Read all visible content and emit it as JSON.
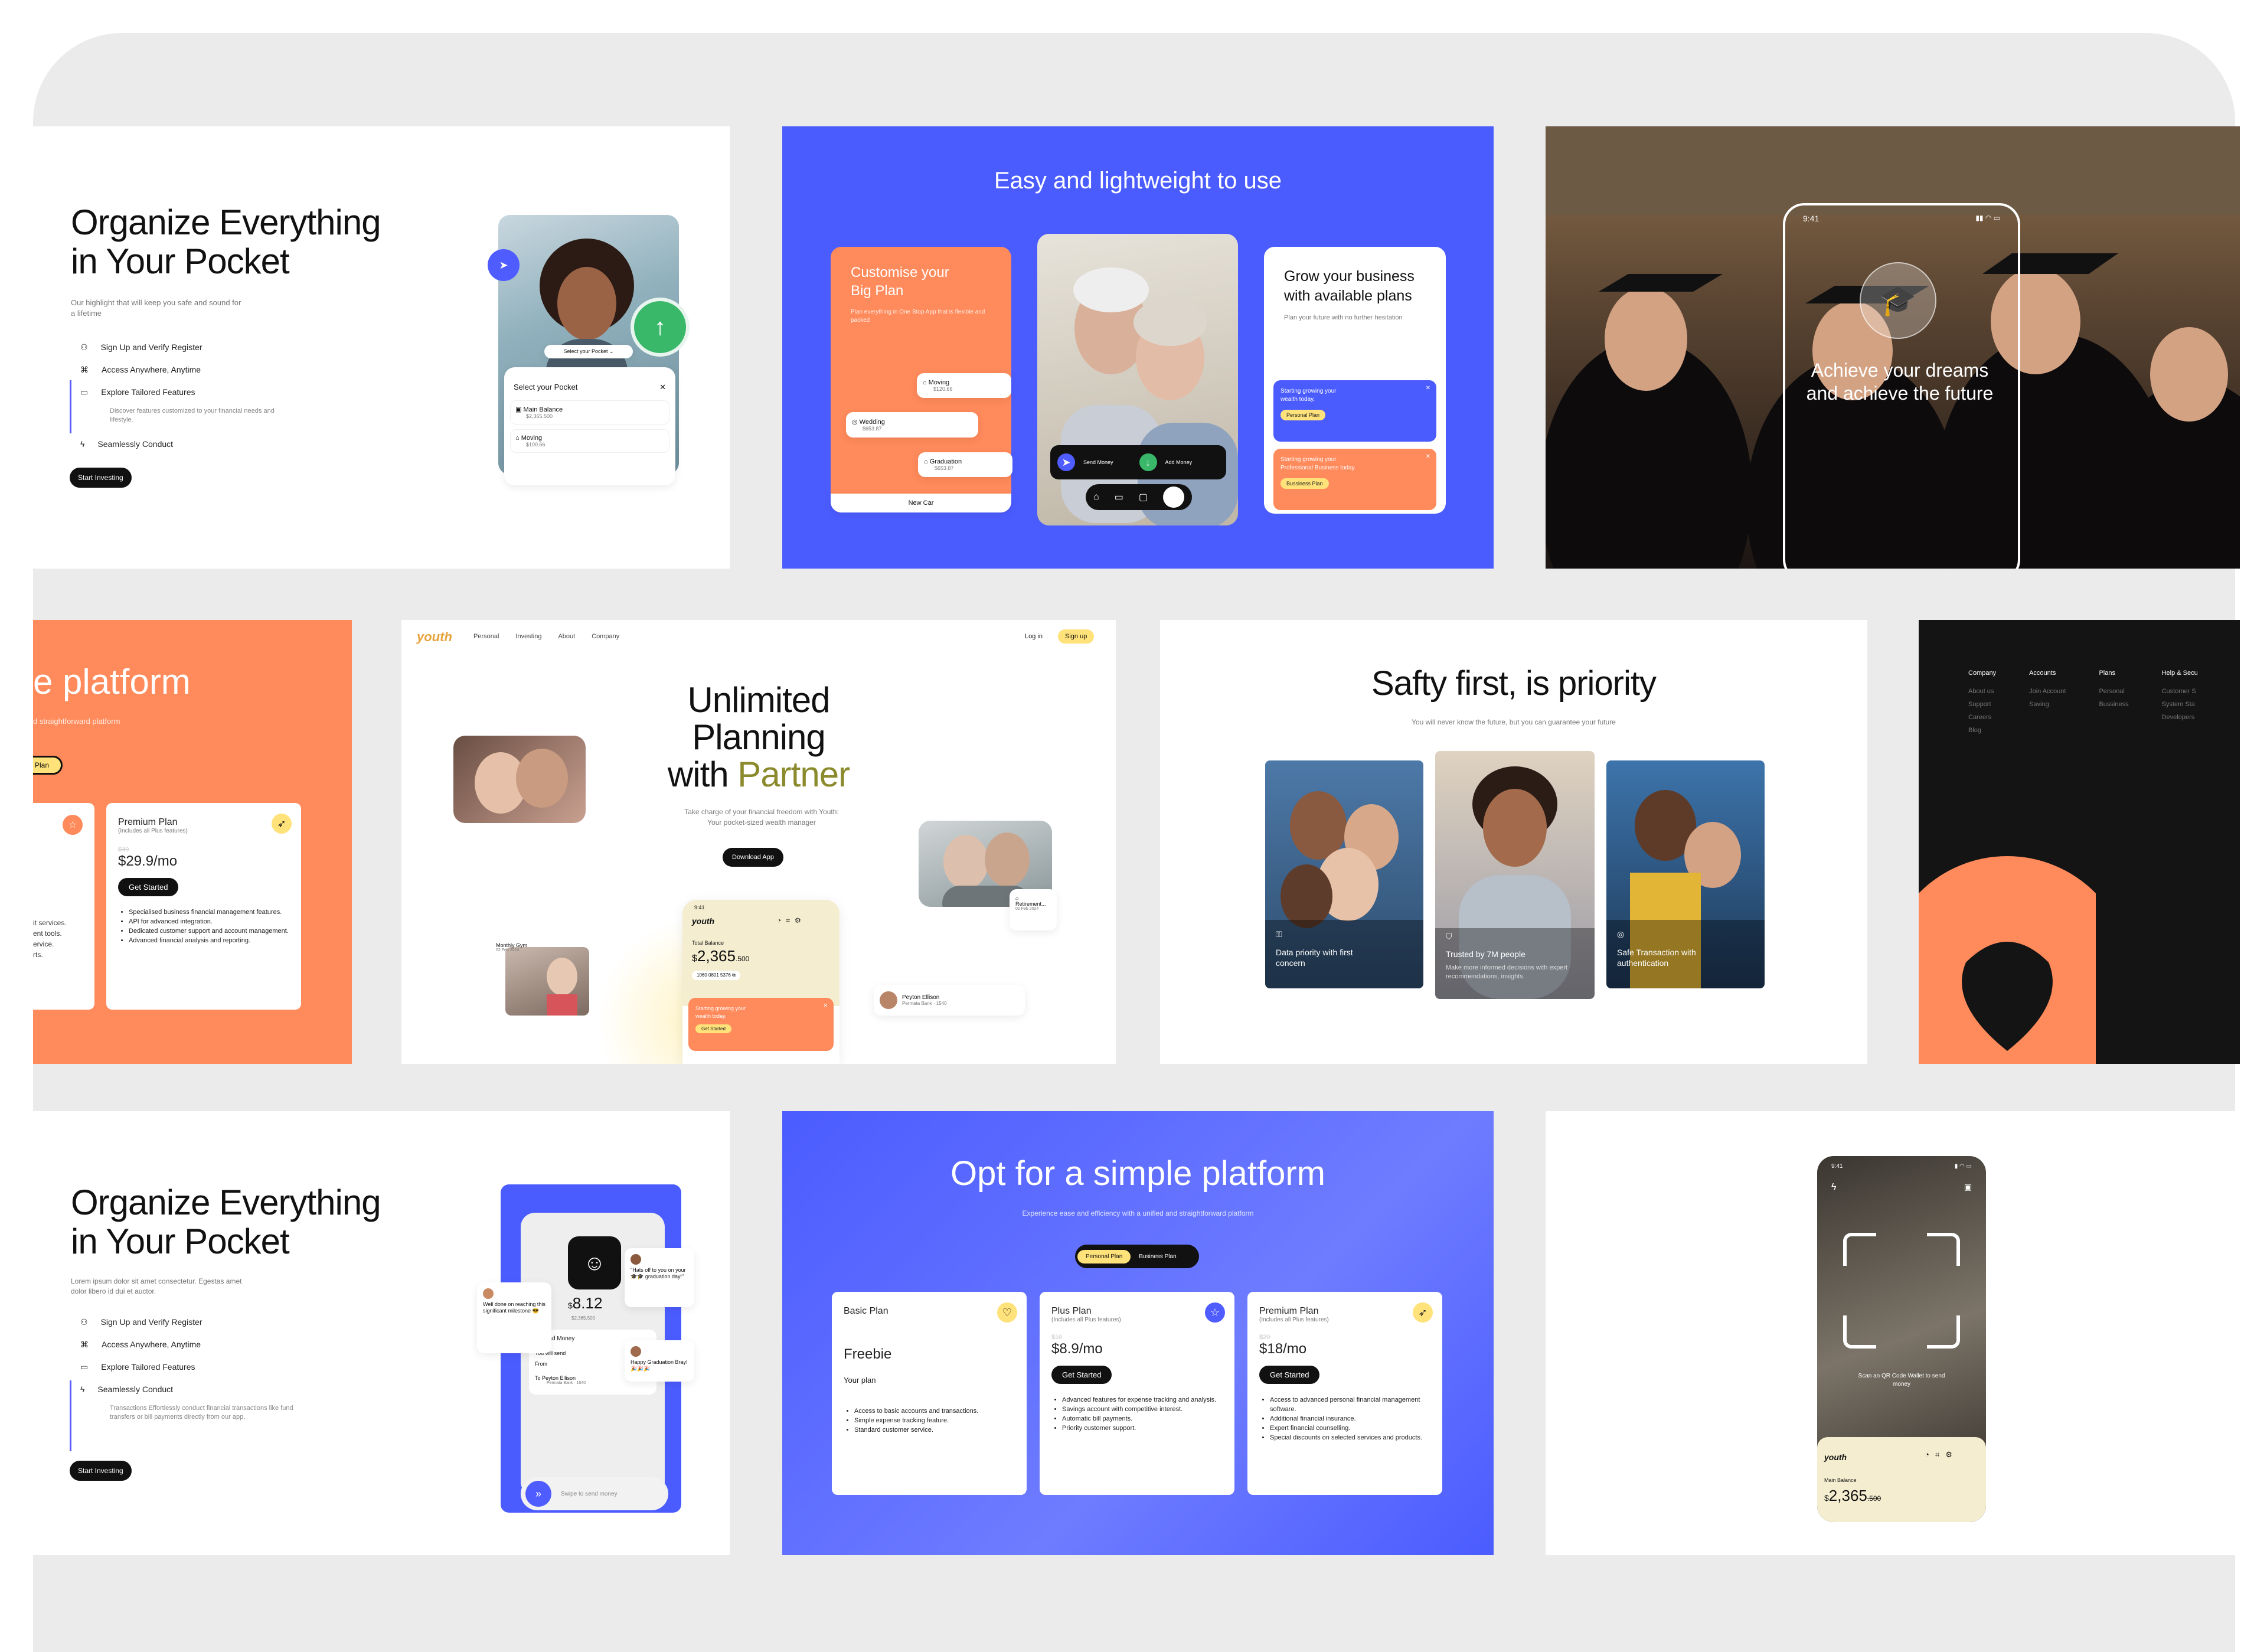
{
  "card1": {
    "title_line1": "Organize Everything",
    "title_line2": "in Your Pocket",
    "subtitle": "Our highlight that will keep you safe and sound for a lifetime",
    "features": [
      "Sign Up and Verify Register",
      "Access Anywhere, Anytime",
      "Explore Tailored Features",
      "Seamlessly Conduct"
    ],
    "feature_sub": "Discover features customized to your financial needs and lifestyle.",
    "cta": "Start Investing",
    "dropdown": "Select your Pocket",
    "sheet_title": "Select your Pocket",
    "rows": [
      {
        "name": "Main Balance",
        "value": "$2,365.500"
      },
      {
        "name": "Moving",
        "value": "$100.66"
      }
    ]
  },
  "card2": {
    "title": "Easy and lightweight to use",
    "orange_title": "Customise your Big Plan",
    "orange_sub": "Plan everything in One Stop App that is flexible and packed",
    "items": [
      {
        "name": "Moving",
        "value": "$120.66"
      },
      {
        "name": "Wedding",
        "value": "$653.87"
      },
      {
        "name": "Graduation",
        "value": "$653.87"
      },
      {
        "name": "New Car",
        "value": ""
      }
    ],
    "send": "Send Money",
    "add": "Add Money",
    "right_title": "Grow your business with available plans",
    "right_sub": "Plan your future with no further hesitation",
    "blue_box": "Starting growing your wealth today.",
    "blue_btn": "Personal Plan",
    "orange_box": "Starting growing your Professional Business today.",
    "orange_btn": "Bussiness Plan"
  },
  "card3": {
    "time": "9:41",
    "headline": "Achieve your dreams and achieve the future"
  },
  "card4": {
    "title": "e platform",
    "sub": "d straightforward platform",
    "pill": "Plan",
    "plan_name": "Premium Plan",
    "plan_note": "(Includes all Plus features)",
    "old": "$40",
    "price": "$29.9/mo",
    "btn": "Get Started",
    "left_frag": [
      "it services.",
      "ent tools.",
      "ervice.",
      "rts."
    ],
    "bullets": [
      "Specialised business financial management features.",
      "API for advanced integration.",
      "Dedicated customer support and account management.",
      "Advanced financial analysis and reporting."
    ]
  },
  "card5": {
    "logo": "youth",
    "nav": [
      "Personal",
      "Investing",
      "About",
      "Company"
    ],
    "login": "Log in",
    "signup": "Sign up",
    "h1": "Unlimited",
    "h2": "Planning",
    "h3a": "with ",
    "h3b": "Partner",
    "sub": "Take charge of your financial freedom with Youth: Your pocket-sized wealth manager",
    "cta": "Download App",
    "time": "9:41",
    "app_logo": "youth",
    "balance_label": "Total Balance",
    "balance_cur": "$",
    "balance": "2,365",
    "balance_dec": ".500",
    "account": "1060 0801 5376",
    "promo": "Starting growing your wealth today.",
    "promo_btn": "Get Started",
    "gym": "Monthly Gym",
    "gym_date": "02 Feb 2024",
    "retire": "Retirement...",
    "retire_date": "02 Feb 2024",
    "peyton": "Peyton Ellison",
    "peyton_bank": "Permata Bank · 1540"
  },
  "card6": {
    "title": "Safty first, is priority",
    "sub": "You will never know the future, but you can guarantee your future",
    "cards": [
      {
        "text": "Data priority with first concern",
        "sub": ""
      },
      {
        "text": "Trusted by 7M people",
        "sub": "Make more informed decisions with expert recommendations, insights."
      },
      {
        "text": "Safe Transaction with authentication",
        "sub": ""
      }
    ]
  },
  "card7": {
    "cols": [
      {
        "h": "Company",
        "items": [
          "About us",
          "Support",
          "Careers",
          "Blog"
        ]
      },
      {
        "h": "Accounts",
        "items": [
          "Join Account",
          "Saving"
        ]
      },
      {
        "h": "Plans",
        "items": [
          "Personal",
          "Bussiness"
        ]
      },
      {
        "h": "Help & Secu",
        "items": [
          "Customer S",
          "System Sta",
          "Developers"
        ]
      }
    ]
  },
  "card8": {
    "title_line1": "Organize Everything",
    "title_line2": "in Your Pocket",
    "subtitle": "Lorem ipsum dolor sit amet consectetur. Egestas amet dolor libero id dui et auctor.",
    "features": [
      "Sign Up and Verify Register",
      "Access Anywhere, Anytime",
      "Explore Tailored Features",
      "Seamlessly Conduct"
    ],
    "feature_sub": "Transactions Effortlessly conduct financial transactions like fund transfers or bill payments directly from our app.",
    "cta": "Start Investing",
    "amount": "8.12",
    "amount_cur": "$",
    "amount_sub": "$2,365.500",
    "send": "Send Money",
    "will_send": "You will send",
    "from": "From",
    "to": "To",
    "to_name": "Peyton Ellison",
    "to_bank": "Permata Bank · 1540",
    "swipe": "Swipe to send money",
    "chat1": "Well done on reaching this significant milestone 😎",
    "chat2": "\"Hats off to you on your 🎓🎓 graduation day!\"",
    "chat3": "Happy Graduation Bray! 🎉🎉🎉"
  },
  "card9": {
    "title": "Opt for a simple platform",
    "sub": "Experience ease and efficiency with a unified and straightforward platform",
    "toggle1": "Personal Plan",
    "toggle2": "Business Plan",
    "plans": [
      {
        "name": "Basic Plan",
        "note": "",
        "old": "",
        "price": "Freebie",
        "btn": "Your plan",
        "bullets": [
          "Access to basic accounts and transactions.",
          "Simple expense tracking feature.",
          "Standard customer service."
        ]
      },
      {
        "name": "Plus Plan",
        "note": "(Includes all Plus features)",
        "old": "$10",
        "price": "$8.9/mo",
        "btn": "Get Started",
        "bullets": [
          "Advanced features for expense tracking and analysis.",
          "Savings account with competitive interest.",
          "Automatic bill payments.",
          "Priority customer support."
        ]
      },
      {
        "name": "Premium Plan",
        "note": "(Includes all Plus features)",
        "old": "$20",
        "price": "$18/mo",
        "btn": "Get Started",
        "bullets": [
          "Access to advanced personal financial management software.",
          "Additional financial insurance.",
          "Expert financial counselling.",
          "Special discounts on selected services and products."
        ]
      }
    ]
  },
  "card10": {
    "time": "9:41",
    "scan": "Scan an QR Code Wallet to send money",
    "logo": "youth",
    "label": "Main Balance",
    "cur": "$",
    "amount": "2,365",
    "dec": ".500"
  }
}
